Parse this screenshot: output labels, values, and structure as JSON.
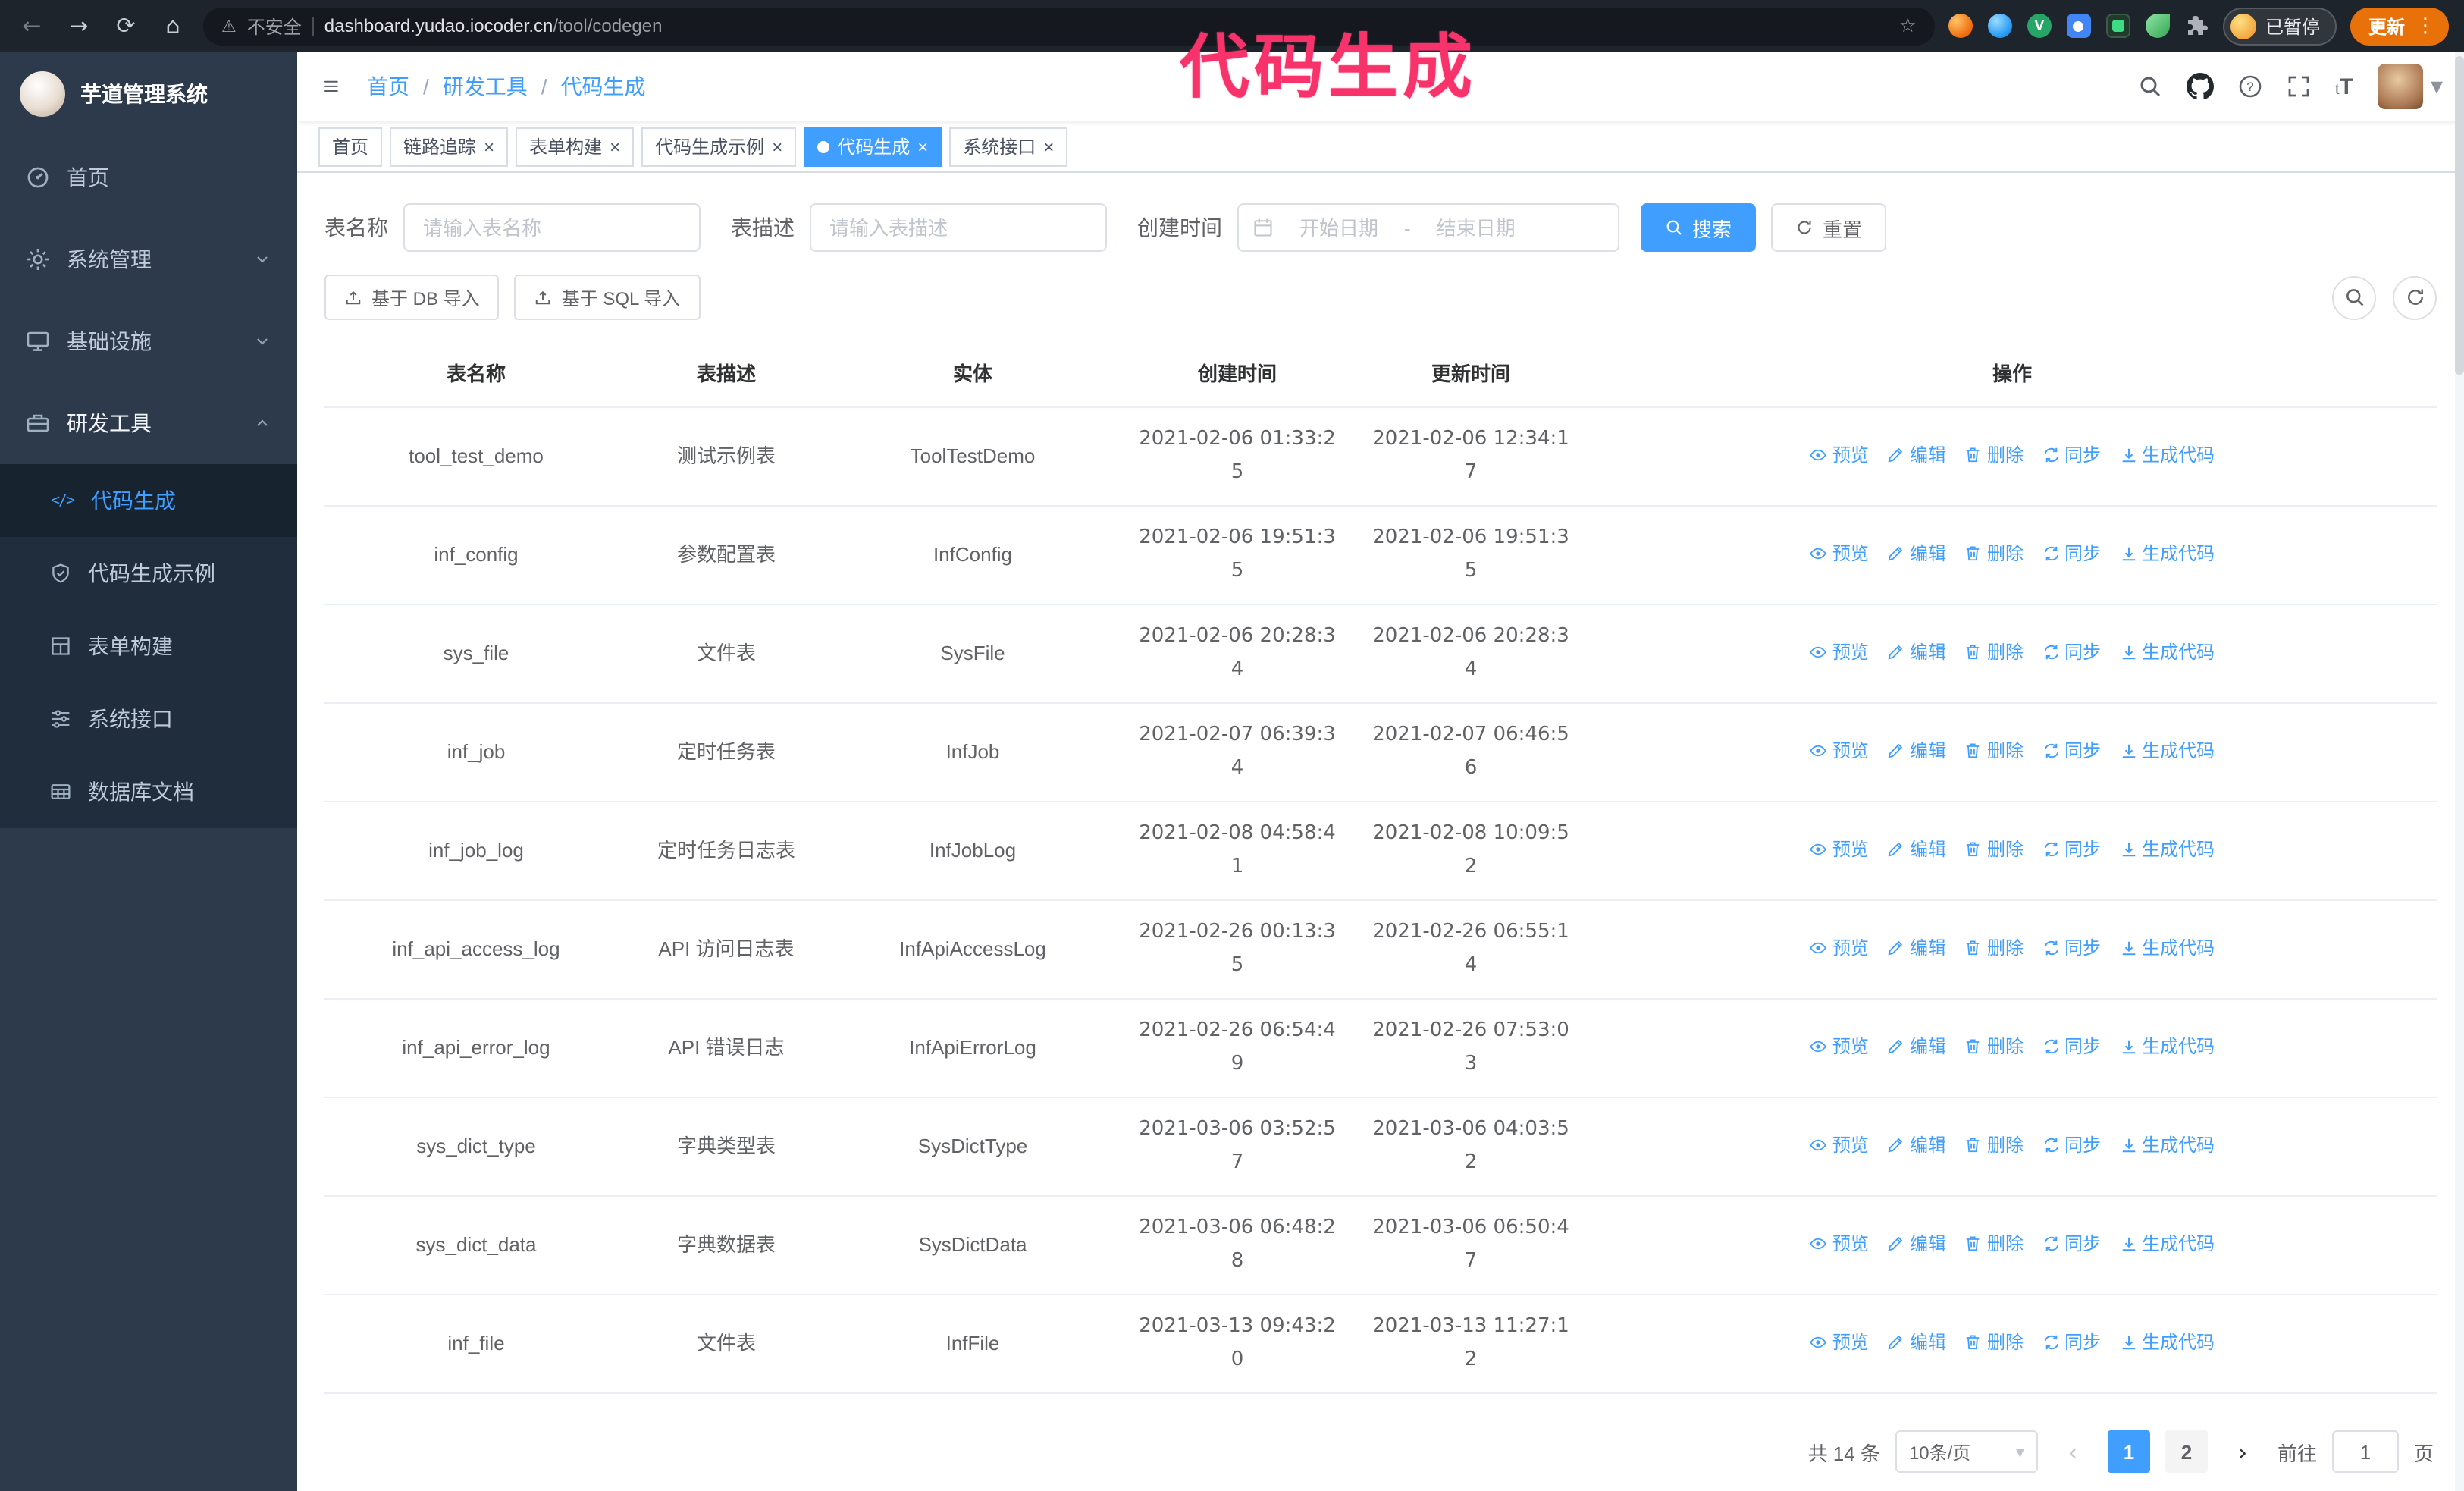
{
  "colors": {
    "accent": "#409eff",
    "annotation": "#f8336b",
    "sidebar_bg": "#2d3a4b",
    "submenu_bg": "#1f2d3d",
    "update_button_bg": "#e8710a",
    "browser_bar_bg": "#1e242c"
  },
  "glyphs": {
    "back": "←",
    "forward": "→",
    "reload": "⟳",
    "home": "⌂",
    "warning": "⚠",
    "star": "☆",
    "menu_dots": "⋮",
    "caret_down": "▾",
    "page_prev": "‹",
    "page_next": "›",
    "close": "×",
    "code": "</>",
    "v_badge": "V",
    "breadcrumb_sep": "/",
    "font_small": "t",
    "font_large": "T"
  },
  "annotation": {
    "text": "代码生成"
  },
  "browser": {
    "security_label": "不安全",
    "url_host": "dashboard.yudao.iocoder.cn",
    "url_path": "/tool/codegen",
    "paused_badge": "已暂停",
    "update_button": "更新"
  },
  "sidebar": {
    "logo_title": "芋道管理系统",
    "items": [
      {
        "label": "首页",
        "icon": "home-icon",
        "state": "none"
      },
      {
        "label": "系统管理",
        "icon": "gear-icon",
        "state": "collapsed"
      },
      {
        "label": "基础设施",
        "icon": "monitor-icon",
        "state": "collapsed"
      },
      {
        "label": "研发工具",
        "icon": "toolbox-icon",
        "state": "expanded"
      }
    ],
    "submenu": [
      {
        "label": "代码生成",
        "icon": "code-icon",
        "active": true
      },
      {
        "label": "代码生成示例",
        "icon": "shield-icon",
        "active": false
      },
      {
        "label": "表单构建",
        "icon": "grid-icon",
        "active": false
      },
      {
        "label": "系统接口",
        "icon": "sliders-icon",
        "active": false
      },
      {
        "label": "数据库文档",
        "icon": "dbtable-icon",
        "active": false
      }
    ]
  },
  "header": {
    "breadcrumb": [
      "首页",
      "研发工具",
      "代码生成"
    ]
  },
  "tabs": [
    {
      "label": "首页",
      "closable": false,
      "active": false
    },
    {
      "label": "链路追踪",
      "closable": true,
      "active": false
    },
    {
      "label": "表单构建",
      "closable": true,
      "active": false
    },
    {
      "label": "代码生成示例",
      "closable": true,
      "active": false
    },
    {
      "label": "代码生成",
      "closable": true,
      "active": true
    },
    {
      "label": "系统接口",
      "closable": true,
      "active": false
    }
  ],
  "filters": {
    "table_name_label": "表名称",
    "table_name_placeholder": "请输入表名称",
    "table_desc_label": "表描述",
    "table_desc_placeholder": "请输入表描述",
    "create_time_label": "创建时间",
    "date_start_placeholder": "开始日期",
    "date_separator": "-",
    "date_end_placeholder": "结束日期",
    "search_button": "搜索",
    "reset_button": "重置"
  },
  "toolbar": {
    "import_db_button": "基于 DB 导入",
    "import_sql_button": "基于 SQL 导入"
  },
  "table": {
    "columns": [
      "表名称",
      "表描述",
      "实体",
      "创建时间",
      "更新时间",
      "操作"
    ],
    "actions": [
      {
        "label": "预览",
        "name": "preview",
        "icon": "eye-icon"
      },
      {
        "label": "编辑",
        "name": "edit",
        "icon": "edit-icon"
      },
      {
        "label": "删除",
        "name": "delete",
        "icon": "delete-icon"
      },
      {
        "label": "同步",
        "name": "sync",
        "icon": "sync-icon"
      },
      {
        "label": "生成代码",
        "name": "generate-code",
        "icon": "download-icon"
      }
    ],
    "rows": [
      {
        "name": "tool_test_demo",
        "desc": "测试示例表",
        "entity": "ToolTestDemo",
        "created": "2021-02-06 01:33:25",
        "updated": "2021-02-06 12:34:17"
      },
      {
        "name": "inf_config",
        "desc": "参数配置表",
        "entity": "InfConfig",
        "created": "2021-02-06 19:51:35",
        "updated": "2021-02-06 19:51:35"
      },
      {
        "name": "sys_file",
        "desc": "文件表",
        "entity": "SysFile",
        "created": "2021-02-06 20:28:34",
        "updated": "2021-02-06 20:28:34"
      },
      {
        "name": "inf_job",
        "desc": "定时任务表",
        "entity": "InfJob",
        "created": "2021-02-07 06:39:34",
        "updated": "2021-02-07 06:46:56"
      },
      {
        "name": "inf_job_log",
        "desc": "定时任务日志表",
        "entity": "InfJobLog",
        "created": "2021-02-08 04:58:41",
        "updated": "2021-02-08 10:09:52"
      },
      {
        "name": "inf_api_access_log",
        "desc": "API 访问日志表",
        "entity": "InfApiAccessLog",
        "created": "2021-02-26 00:13:35",
        "updated": "2021-02-26 06:55:14"
      },
      {
        "name": "inf_api_error_log",
        "desc": "API 错误日志",
        "entity": "InfApiErrorLog",
        "created": "2021-02-26 06:54:49",
        "updated": "2021-02-26 07:53:03"
      },
      {
        "name": "sys_dict_type",
        "desc": "字典类型表",
        "entity": "SysDictType",
        "created": "2021-03-06 03:52:57",
        "updated": "2021-03-06 04:03:52"
      },
      {
        "name": "sys_dict_data",
        "desc": "字典数据表",
        "entity": "SysDictData",
        "created": "2021-03-06 06:48:28",
        "updated": "2021-03-06 06:50:47"
      },
      {
        "name": "inf_file",
        "desc": "文件表",
        "entity": "InfFile",
        "created": "2021-03-13 09:43:20",
        "updated": "2021-03-13 11:27:12"
      }
    ]
  },
  "pagination": {
    "total_text": "共 14 条",
    "page_size": "10条/页",
    "pages": [
      "1",
      "2"
    ],
    "active_page": "1",
    "goto_label": "前往",
    "goto_value": "1",
    "goto_suffix": "页"
  }
}
